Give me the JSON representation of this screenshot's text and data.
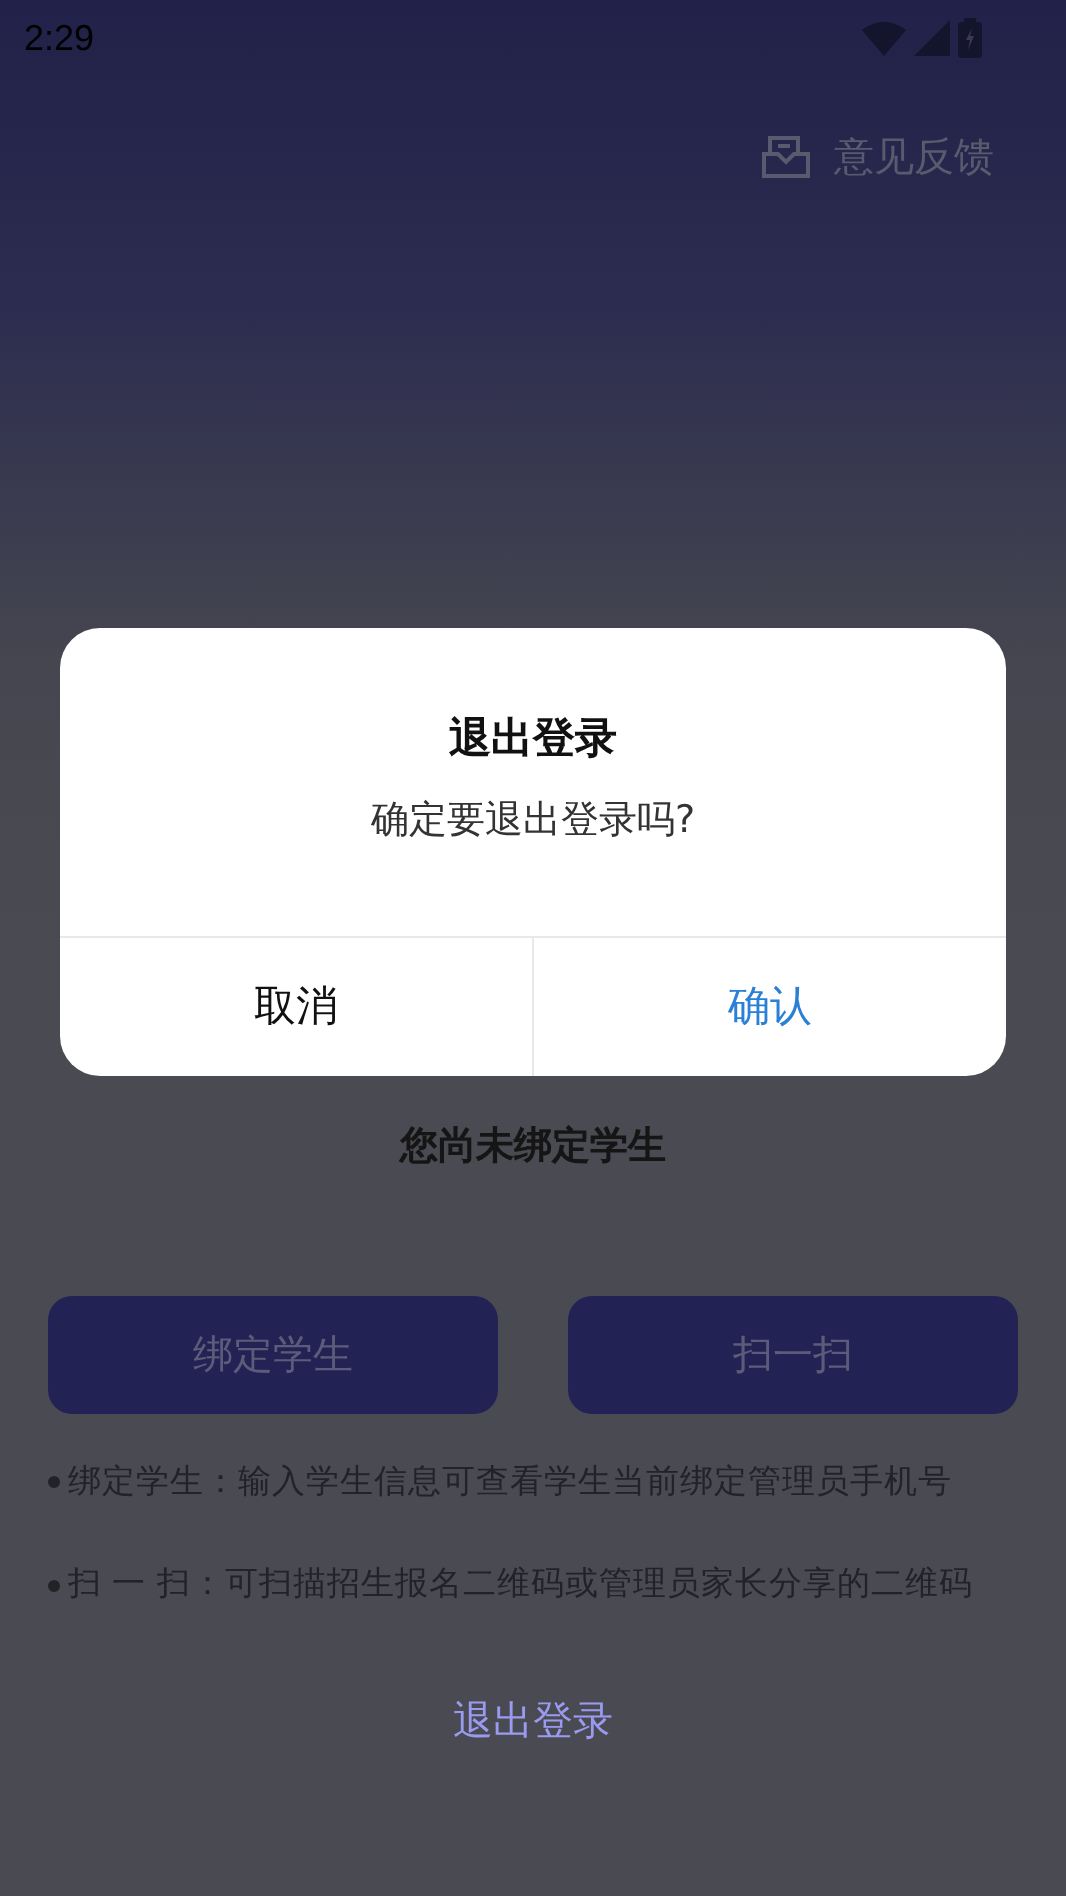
{
  "status_bar": {
    "time": "2:29"
  },
  "header": {
    "feedback": "意见反馈"
  },
  "main": {
    "notice": "您尚未绑定学生",
    "buttons": [
      "绑定学生",
      "扫一扫"
    ],
    "tips": [
      "绑定学生：输入学生信息可查看学生当前绑定管理员手机号",
      "扫 一 扫：可扫描招生报名二维码或管理员家长分享的二维码"
    ],
    "logout": "退出登录"
  },
  "dialog": {
    "title": "退出登录",
    "message": "确定要退出登录吗?",
    "cancel": "取消",
    "confirm": "确认"
  }
}
